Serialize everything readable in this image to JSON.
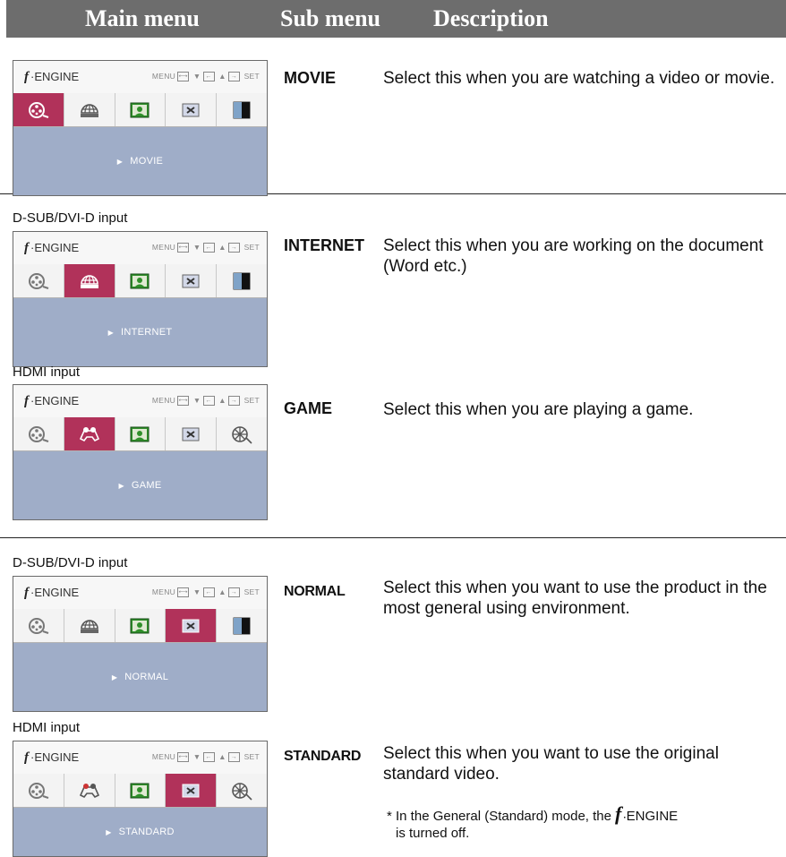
{
  "header": {
    "main_menu": "Main menu",
    "sub_menu": "Sub menu",
    "description": "Description"
  },
  "osd_common": {
    "brand_mark": "f",
    "brand": "ENGINE",
    "menu_label": "MENU",
    "set_label": "SET"
  },
  "sections": [
    {
      "input_label": "",
      "submenu": "MOVIE",
      "description": "Select this when you are watching a video or movie.",
      "osd_label": "MOVIE",
      "icons": [
        "movie-icon",
        "internet-icon",
        "picture-icon",
        "normal-icon",
        "contrast-icon"
      ],
      "selected_index": 0
    },
    {
      "input_label": "D-SUB/DVI-D input",
      "submenu": "INTERNET",
      "description": "Select this when you are working on the document (Word etc.)",
      "osd_label": "INTERNET",
      "icons": [
        "movie-icon",
        "internet-icon",
        "picture-icon",
        "normal-icon",
        "contrast-icon"
      ],
      "selected_index": 1
    },
    {
      "input_label": "HDMI input",
      "submenu": "GAME",
      "description": "Select this when you are playing a game.",
      "osd_label": "GAME",
      "icons": [
        "movie-icon",
        "game-icon",
        "picture-icon",
        "normal-icon",
        "film-reel-icon"
      ],
      "selected_index": 1
    },
    {
      "input_label": "D-SUB/DVI-D input",
      "submenu": "NORMAL",
      "description": "Select this when you want to use the product in the most general using environment.",
      "osd_label": "NORMAL",
      "icons": [
        "movie-icon",
        "internet-icon",
        "picture-icon",
        "normal-icon",
        "contrast-icon"
      ],
      "selected_index": 3
    },
    {
      "input_label": "HDMI input",
      "submenu": "STANDARD",
      "description": "Select this when you want to use the original standard video.",
      "osd_label": "STANDARD",
      "icons": [
        "movie-icon",
        "game-icon",
        "picture-icon",
        "normal-icon",
        "film-reel-icon"
      ],
      "selected_index": 3
    }
  ],
  "note": {
    "prefix": "* In the General (Standard) mode, the",
    "brand": "ENGINE",
    "suffix": "is turned off."
  },
  "colors": {
    "selected": "#b1325a",
    "submenu_bar": "#9fadc8",
    "header_bg": "#6d6d6d"
  }
}
